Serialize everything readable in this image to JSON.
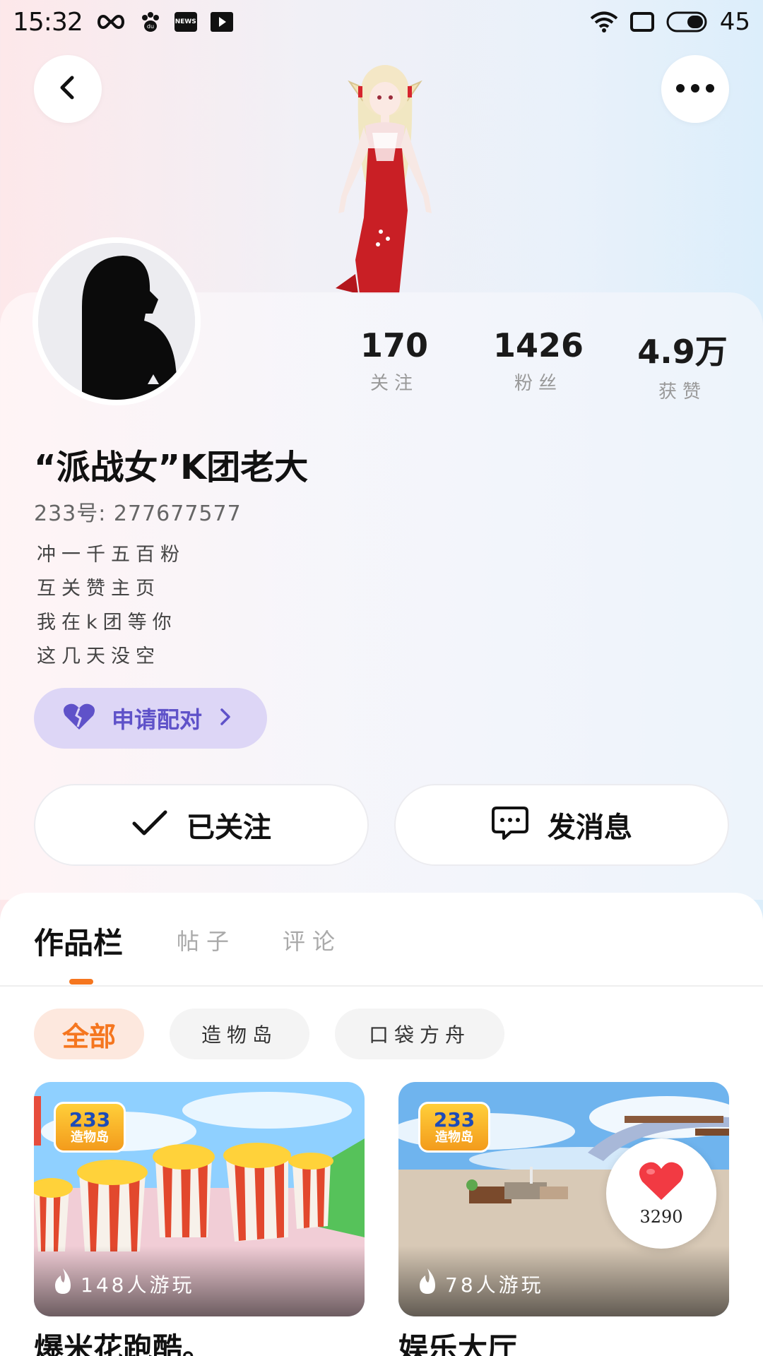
{
  "status_bar": {
    "time": "15:32",
    "battery": "45",
    "news_icon_text": "NEWS",
    "icons": [
      "infinity-icon",
      "paw-icon",
      "news-icon",
      "play-icon",
      "wifi-icon",
      "screen-rotate-icon",
      "battery-icon"
    ]
  },
  "header": {
    "back_icon": "chevron-left-icon",
    "more_icon": "more-dots-icon"
  },
  "profile": {
    "stats": [
      {
        "value": "170",
        "label": "关注"
      },
      {
        "value": "1426",
        "label": "粉丝"
      },
      {
        "value": "4.9万",
        "label": "获赞"
      }
    ],
    "username": "“派战女”K团老大",
    "id_line": "233号:  277677577",
    "bio": [
      "冲一千五百粉",
      "互关赞主页",
      "我在k团等你",
      "这几天没空"
    ],
    "pair_button": "申请配对",
    "follow_button": "已关注",
    "message_button": "发消息"
  },
  "tabs": {
    "works": "作品栏",
    "posts": "帖子",
    "comments": "评论"
  },
  "filters": [
    "全部",
    "造物岛",
    "口袋方舟"
  ],
  "games": [
    {
      "players": "148人游玩",
      "title": "爆米花跑酷。",
      "logo_top": "233",
      "logo_bottom": "造物岛"
    },
    {
      "players": "78人游玩",
      "title": "娱乐大厅",
      "logo_top": "233",
      "logo_bottom": "造物岛"
    }
  ],
  "like_badge": {
    "count": "3290"
  },
  "colors": {
    "accent_orange": "#f5761f",
    "pair_purple": "#5f52c9",
    "pair_bg": "#ddd6f6",
    "heart_red": "#f23a43"
  }
}
